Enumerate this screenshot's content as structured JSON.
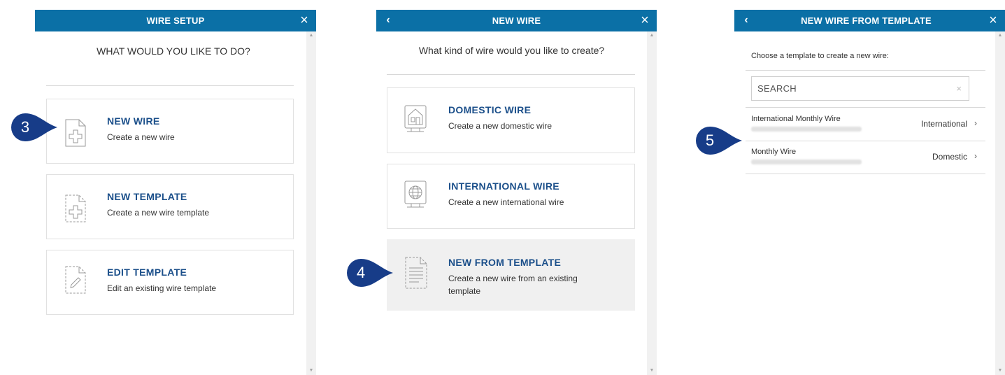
{
  "panel1": {
    "title": "WIRE SETUP",
    "close_icon": "×",
    "question": "WHAT WOULD YOU LIKE TO DO?",
    "options": [
      {
        "title": "NEW WIRE",
        "desc": "Create a new wire",
        "icon": "new-file-icon"
      },
      {
        "title": "NEW TEMPLATE",
        "desc": "Create a new wire template",
        "icon": "new-template-icon"
      },
      {
        "title": "EDIT TEMPLATE",
        "desc": "Edit an existing wire template",
        "icon": "edit-template-icon"
      }
    ]
  },
  "panel2": {
    "title": "NEW WIRE",
    "back_icon": "‹",
    "close_icon": "×",
    "question": "What kind of wire would you like to create?",
    "options": [
      {
        "title": "DOMESTIC WIRE",
        "desc": "Create a new domestic wire",
        "icon": "domestic-building-icon"
      },
      {
        "title": "INTERNATIONAL WIRE",
        "desc": "Create a new international wire",
        "icon": "globe-icon"
      },
      {
        "title": "NEW FROM TEMPLATE",
        "desc_line1": "Create a new wire from an existing",
        "desc_line2": "template",
        "icon": "template-document-icon"
      }
    ]
  },
  "panel3": {
    "title": "NEW WIRE FROM TEMPLATE",
    "back_icon": "‹",
    "close_icon": "×",
    "hint": "Choose a template to create a new wire:",
    "search_placeholder": "SEARCH",
    "search_clear": "×",
    "templates": [
      {
        "name": "International Monthly Wire",
        "type": "International",
        "chevron": "›"
      },
      {
        "name": "Monthly Wire",
        "type": "Domestic",
        "chevron": "›"
      }
    ]
  },
  "markers": {
    "step3": "3",
    "step4": "4",
    "step5": "5"
  },
  "colors": {
    "header": "#0b70a6",
    "title_blue": "#1b4f8a",
    "marker": "#173c88",
    "active_card": "#f0f0f0"
  }
}
